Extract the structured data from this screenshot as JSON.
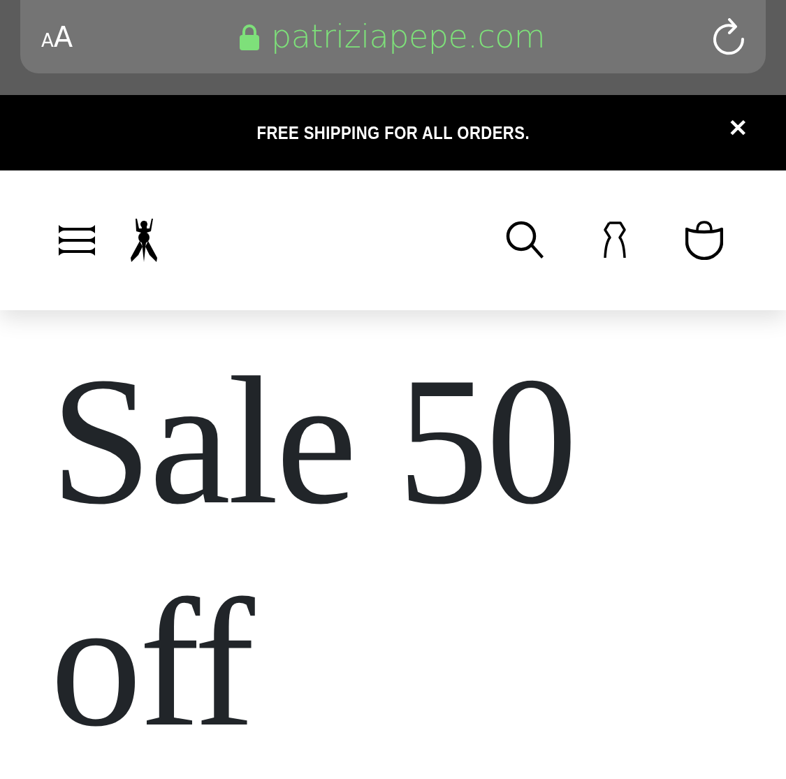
{
  "browser_bar": {
    "reader_button": {
      "small": "A",
      "large": "A"
    },
    "url": "patriziapepe.com",
    "secure": true
  },
  "banner": {
    "text": "FREE SHIPPING FOR ALL ORDERS.",
    "close": "✕"
  },
  "hero": {
    "heading": "Sale 50 off"
  }
}
